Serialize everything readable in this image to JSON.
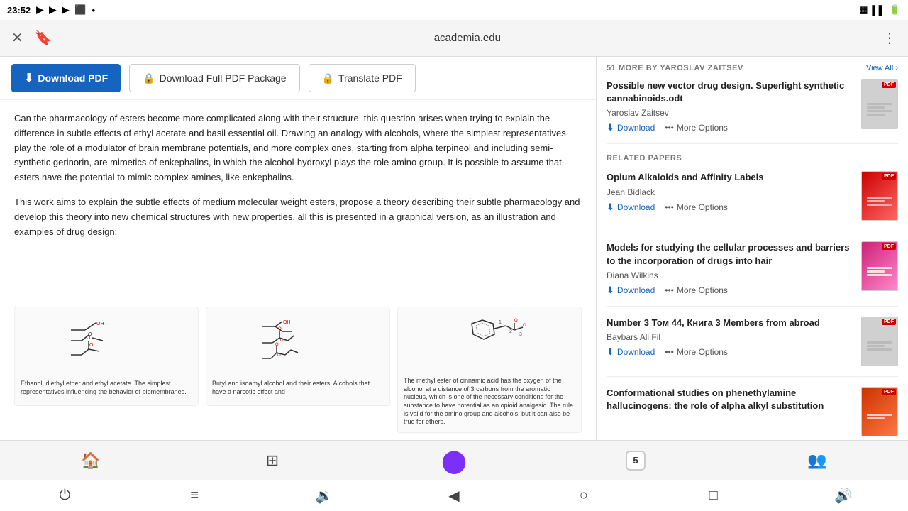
{
  "statusBar": {
    "time": "23:52",
    "icons": [
      "yt-music",
      "yt",
      "yt-alt",
      "record",
      "dot"
    ]
  },
  "browserBar": {
    "url": "academia.edu",
    "closeIcon": "✕",
    "bookmarkIcon": "🔖",
    "menuIcon": "⋮"
  },
  "downloadButtons": {
    "downloadPdf": "Download PDF",
    "downloadPackage": "Download Full PDF Package",
    "translatePdf": "Translate PDF"
  },
  "pdfContent": {
    "paragraph1": "Can the pharmacology of esters become more complicated along with their structure, this question arises when trying to explain the difference in subtle effects of ethyl acetate and basil essential oil. Drawing an analogy with alcohols, where the simplest representatives play the role of a modulator of brain membrane potentials, and more complex ones, starting from alpha terpineol and including semi-synthetic gerinorin, are mimetics of enkephalins, in which the alcohol-hydroxyl plays the role amino group. It is possible to assume that esters have the potential to mimic complex amines, like enkephalins.",
    "paragraph2": "This work aims to explain the subtle effects of medium molecular weight esters, propose a theory describing their subtle pharmacology and develop this theory into new chemical structures with new properties, all this is presented in a graphical version, as an illustration and examples of drug design:",
    "chemLabel1": "Ethanol, diethyl ether and ethyl acetate. The simplest representatives influencing the behavior of biomembranes.",
    "chemLabel2": "Butyl and isoamyl alcohol and their esters. Alcohols that have a narcotic effect and",
    "chemLabel3": "The methyl ester of cinnamic acid has the oxygen of the alcohol at a distance of 3 carbons from the aromatic nucleus, which is one of the necessary conditions for the substance to have potential as an opioid analgesic. The rule is valid for the amino group and alcohols, but it can also be true for ethers."
  },
  "sidebar": {
    "moreBySection": "51 MORE BY YAROSLAV ZAITSEV",
    "viewAllLabel": "View All",
    "papers": [
      {
        "id": "paper-1",
        "title": "Possible new vector drug design. Superlight synthetic cannabinoids.odt",
        "author": "Yaroslav Zaitsev",
        "downloadLabel": "Download",
        "moreOptionsLabel": "More Options",
        "thumbType": "gray-lines"
      }
    ],
    "relatedSection": "RELATED PAPERS",
    "relatedPapers": [
      {
        "id": "related-1",
        "title": "Opium Alkaloids and Affinity Labels",
        "author": "Jean Bidlack",
        "downloadLabel": "Download",
        "moreOptionsLabel": "More Options",
        "thumbType": "red"
      },
      {
        "id": "related-2",
        "title": "Models for studying the cellular processes and barriers to the incorporation of drugs into hair",
        "author": "Diana Wilkins",
        "downloadLabel": "Download",
        "moreOptionsLabel": "More Options",
        "thumbType": "pink"
      },
      {
        "id": "related-3",
        "title": "Number 3 Том 44, Книга 3 Members from abroad",
        "author": "Baybars Ali Fil",
        "downloadLabel": "Download",
        "moreOptionsLabel": "More Options",
        "thumbType": "gray-lines-small"
      },
      {
        "id": "related-4",
        "title": "Conformational studies on phenethylamine hallucinogens: the role of alpha alkyl substitution",
        "author": "",
        "downloadLabel": "Download",
        "moreOptionsLabel": "More Options",
        "thumbType": "red"
      }
    ]
  },
  "bottomNav": {
    "homeIcon": "🏠",
    "gridIcon": "⊞",
    "recordIcon": "⬤",
    "tabCount": "5",
    "peopleIcon": "👥"
  },
  "systemNav": {
    "powerIcon": "⏻",
    "menuIcon": "≡",
    "volumeIcon": "🔊",
    "backIcon": "◀",
    "homeCircle": "○",
    "squareIcon": "□",
    "soundIcon": "🔊"
  }
}
